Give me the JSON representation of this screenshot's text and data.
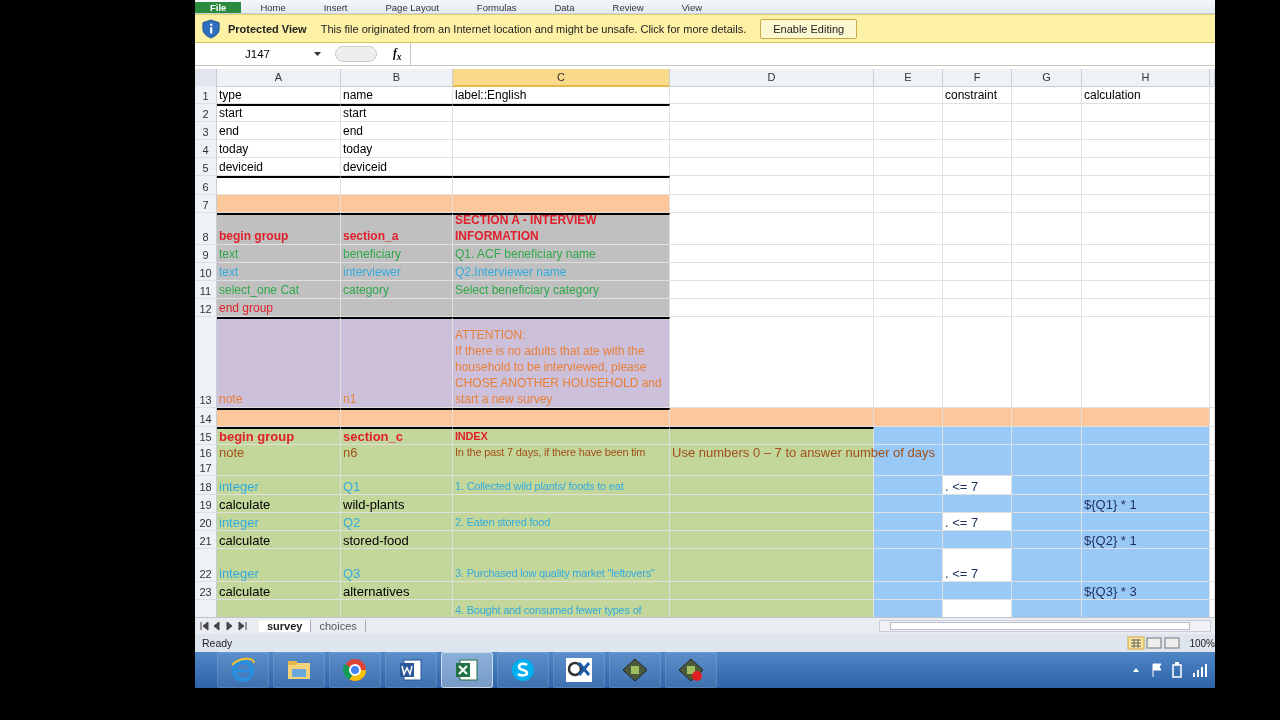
{
  "ribbon_tabs": [
    {
      "label": "File",
      "selected": true
    },
    {
      "label": "Home",
      "selected": false
    },
    {
      "label": "Insert",
      "selected": false
    },
    {
      "label": "Page Layout",
      "selected": false
    },
    {
      "label": "Formulas",
      "selected": false
    },
    {
      "label": "Data",
      "selected": false
    },
    {
      "label": "Review",
      "selected": false
    },
    {
      "label": "View",
      "selected": false
    }
  ],
  "protected_view": {
    "title": "Protected View",
    "message": "This file originated from an Internet location and might be unsafe. Click for more details.",
    "button": "Enable Editing"
  },
  "formula_bar": {
    "name_box": "J147",
    "fx": "f$_{x}$"
  },
  "columns": [
    {
      "label": "A",
      "selected": false
    },
    {
      "label": "B",
      "selected": false
    },
    {
      "label": "C",
      "selected": true
    },
    {
      "label": "D",
      "selected": false
    },
    {
      "label": "E",
      "selected": false
    },
    {
      "label": "F",
      "selected": false
    },
    {
      "label": "G",
      "selected": false
    },
    {
      "label": "H",
      "selected": false
    }
  ],
  "rows": [
    {
      "number": "1",
      "kind": "plain",
      "rule_above": false,
      "cells": {
        "A": {
          "text": "type",
          "color": "#000000"
        },
        "B": {
          "text": "name",
          "color": "#000000"
        },
        "C": {
          "text": "label::English",
          "color": "#000000"
        },
        "F": {
          "text": "constraint",
          "color": "#000000"
        },
        "H": {
          "text": "calculation",
          "color": "#000000"
        }
      }
    },
    {
      "number": "2",
      "kind": "plain",
      "rule_above": true,
      "cells": {
        "A": {
          "text": "start",
          "color": "#000000"
        },
        "B": {
          "text": "start",
          "color": "#000000"
        }
      }
    },
    {
      "number": "3",
      "kind": "plain",
      "rule_above": false,
      "cells": {
        "A": {
          "text": "end",
          "color": "#000000"
        },
        "B": {
          "text": "end",
          "color": "#000000"
        }
      }
    },
    {
      "number": "4",
      "kind": "plain",
      "rule_above": false,
      "cells": {
        "A": {
          "text": "today",
          "color": "#000000"
        },
        "B": {
          "text": "today",
          "color": "#000000"
        }
      }
    },
    {
      "number": "5",
      "kind": "plain",
      "rule_above": false,
      "cells": {
        "A": {
          "text": "deviceid",
          "color": "#000000"
        },
        "B": {
          "text": "deviceid",
          "color": "#000000"
        }
      }
    },
    {
      "number": "6",
      "kind": "plain",
      "rule_above": true,
      "cells": {}
    },
    {
      "number": "7",
      "kind": "orange",
      "rule_above": false,
      "cells": {}
    },
    {
      "number": "8",
      "kind": "gray",
      "rule_above": true,
      "cells": {
        "A": {
          "text": "begin group",
          "color": "#e0202a",
          "bold": true
        },
        "B": {
          "text": "section_a",
          "color": "#e0202a",
          "bold": true
        },
        "C": {
          "text": "SECTION A - INTERVIEW INFORMATION",
          "color": "#e0202a",
          "bold": true,
          "wrap": true
        }
      }
    },
    {
      "number": "9",
      "kind": "gray",
      "rule_above": false,
      "cells": {
        "A": {
          "text": "text",
          "color": "#2ea84a"
        },
        "B": {
          "text": "beneficiary",
          "color": "#2ea84a"
        },
        "C": {
          "text": "Q1. ACF beneficiary name",
          "color": "#2ea84a"
        }
      }
    },
    {
      "number": "10",
      "kind": "gray",
      "rule_above": false,
      "cells": {
        "A": {
          "text": "text",
          "color": "#33aadd"
        },
        "B": {
          "text": "interviewer",
          "color": "#33aadd"
        },
        "C": {
          "text": "Q2.Interviewer name",
          "color": "#33aadd"
        }
      }
    },
    {
      "number": "11",
      "kind": "gray",
      "rule_above": false,
      "cells": {
        "A": {
          "text": "select_one Cat",
          "color": "#2ea84a"
        },
        "B": {
          "text": "category",
          "color": "#2ea84a"
        },
        "C": {
          "text": "Select beneficiary category",
          "color": "#2ea84a"
        }
      }
    },
    {
      "number": "12",
      "kind": "gray",
      "rule_above": false,
      "cells": {
        "A": {
          "text": "end group",
          "color": "#e0202a"
        }
      }
    },
    {
      "number": "13",
      "kind": "purple",
      "rule_above": true,
      "cells": {
        "A": {
          "text": "note",
          "color": "#e8803a"
        },
        "B": {
          "text": "n1",
          "color": "#e8803a"
        },
        "C": {
          "text": "ATTENTION:\nIf there is no adults that ate with the household to be interviewed, please CHOSE ANOTHER HOUSEHOLD and start a new survey",
          "color": "#e8803a",
          "wrap": true
        }
      }
    },
    {
      "number": "14",
      "kind": "orange_wide",
      "rule_above": true,
      "cells": {}
    },
    {
      "number": "15",
      "kind": "green_blue",
      "rule_above": true,
      "cells": {
        "A": {
          "text": "begin group",
          "color": "#e0202a",
          "bold": true
        },
        "B": {
          "text": "section_c",
          "color": "#e0202a",
          "bold": true
        },
        "C": {
          "text": "INDEX",
          "color": "#e0202a",
          "bold": true
        }
      }
    },
    {
      "number": "16",
      "kind": "green_blue",
      "rule_above": false,
      "cells": {
        "A": {
          "text": "note",
          "color": "#a0501a"
        },
        "B": {
          "text": "n6",
          "color": "#a0501a"
        },
        "C": {
          "text": "In the past 7 days, if there have been tim",
          "color": "#a0501a"
        },
        "D": {
          "text": "Use numbers 0 – 7 to answer number of days",
          "color": "#a0501a"
        }
      }
    },
    {
      "number": "17",
      "kind": "green_blue",
      "rule_above": false,
      "cells": {}
    },
    {
      "number": "18",
      "kind": "green_blue",
      "rule_above": false,
      "cells": {
        "A": {
          "text": "integer",
          "color": "#33aadd"
        },
        "B": {
          "text": "Q1",
          "color": "#33aadd"
        },
        "C": {
          "text": "1. Collected wild plants/ foods to eat",
          "color": "#33aadd"
        },
        "F": {
          "text": ". <= 7",
          "color": "#1f2f5f",
          "boxed": true
        }
      }
    },
    {
      "number": "19",
      "kind": "green_blue",
      "rule_above": false,
      "cells": {
        "A": {
          "text": "calculate",
          "color": "#000000"
        },
        "B": {
          "text": "wild-plants",
          "color": "#000000"
        },
        "H": {
          "text": "${Q1} * 1",
          "color": "#1f2f5f"
        }
      }
    },
    {
      "number": "20",
      "kind": "green_blue",
      "rule_above": false,
      "cells": {
        "A": {
          "text": "integer",
          "color": "#33aadd"
        },
        "B": {
          "text": "Q2",
          "color": "#33aadd"
        },
        "C": {
          "text": "2. Eaten stored food",
          "color": "#33aadd"
        },
        "F": {
          "text": ". <= 7",
          "color": "#1f2f5f",
          "boxed": true
        }
      }
    },
    {
      "number": "21",
      "kind": "green_blue",
      "rule_above": false,
      "cells": {
        "A": {
          "text": "calculate",
          "color": "#000000"
        },
        "B": {
          "text": "stored-food",
          "color": "#000000"
        },
        "H": {
          "text": "${Q2} * 1",
          "color": "#1f2f5f"
        }
      }
    },
    {
      "number": "22",
      "kind": "green_blue",
      "rule_above": false,
      "cells": {
        "A": {
          "text": "integer",
          "color": "#33aadd"
        },
        "B": {
          "text": "Q3",
          "color": "#33aadd"
        },
        "C": {
          "text": "3. Purchased low quality market \"leftovers\"",
          "color": "#33aadd",
          "wrap": true
        },
        "F": {
          "text": ". <= 7",
          "color": "#1f2f5f",
          "boxed": true
        }
      }
    },
    {
      "number": "23",
      "kind": "green_blue",
      "rule_above": false,
      "cells": {
        "A": {
          "text": "calculate",
          "color": "#000000"
        },
        "B": {
          "text": "alternatives",
          "color": "#000000"
        },
        "H": {
          "text": "${Q3} * 3",
          "color": "#1f2f5f"
        }
      }
    },
    {
      "kind": "green_blue",
      "rule_above": false,
      "cells": {
        "C": {
          "text": "4. Bought and consumed fewer types of",
          "color": "#33aadd"
        },
        "F": {
          "boxed": true
        }
      }
    }
  ],
  "sheet_tabs": [
    {
      "label": "survey",
      "selected": true
    },
    {
      "label": "choices",
      "selected": false
    }
  ],
  "status_bar": {
    "text": "Ready",
    "zoom": "100%"
  },
  "taskbar": [
    {
      "kind": "ie",
      "selected": false
    },
    {
      "kind": "folder",
      "selected": false
    },
    {
      "kind": "chrome",
      "selected": false
    },
    {
      "kind": "word",
      "selected": false
    },
    {
      "kind": "excel",
      "selected": true
    },
    {
      "kind": "skype",
      "selected": false
    },
    {
      "kind": "xk",
      "selected": false
    },
    {
      "kind": "tool",
      "selected": false
    },
    {
      "kind": "tool_red",
      "selected": false
    }
  ]
}
